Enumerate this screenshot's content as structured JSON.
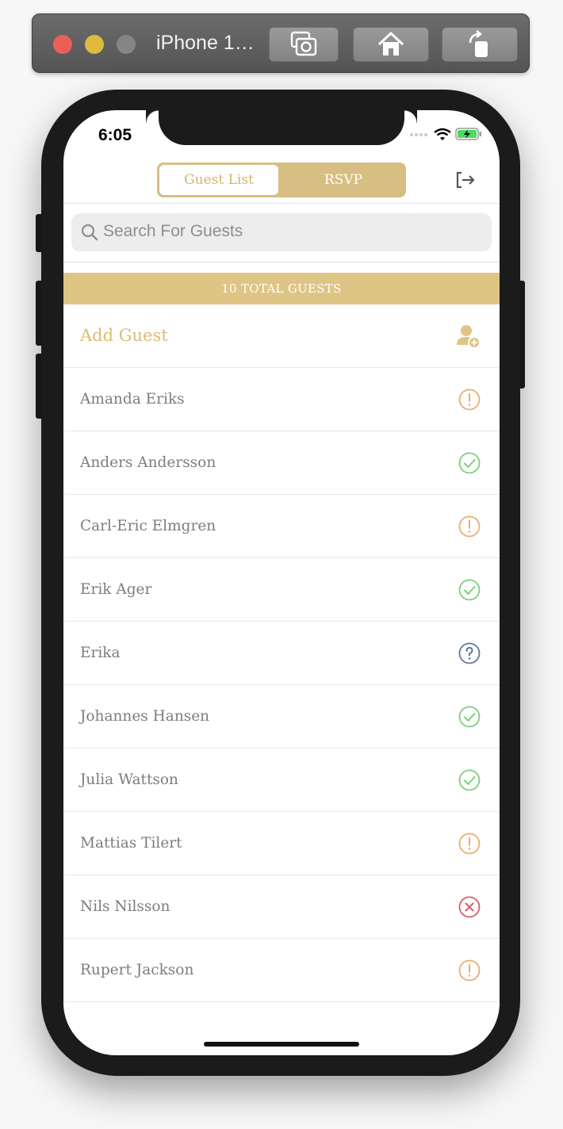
{
  "simulator": {
    "title": "iPhone 1…"
  },
  "status_bar": {
    "time": "6:05"
  },
  "header": {
    "tabs": [
      {
        "label": "Guest List",
        "active": true
      },
      {
        "label": "RSVP",
        "active": false
      }
    ]
  },
  "search": {
    "placeholder": "Search For Guests"
  },
  "banner": {
    "text": "10 TOTAL GUESTS"
  },
  "add_guest": {
    "label": "Add Guest"
  },
  "guests": [
    {
      "name": "Amanda Eriks",
      "status": "pending"
    },
    {
      "name": "Anders Andersson",
      "status": "attending"
    },
    {
      "name": "Carl-Eric Elmgren",
      "status": "pending"
    },
    {
      "name": "Erik Ager",
      "status": "attending"
    },
    {
      "name": "Erika",
      "status": "unknown"
    },
    {
      "name": "Johannes Hansen",
      "status": "attending"
    },
    {
      "name": "Julia Wattson",
      "status": "attending"
    },
    {
      "name": "Mattias Tilert",
      "status": "pending"
    },
    {
      "name": "Nils Nilsson",
      "status": "declined"
    },
    {
      "name": "Rupert Jackson",
      "status": "pending"
    }
  ],
  "colors": {
    "gold": "#d7be82",
    "pending": "#e9ad6e",
    "attending": "#7ccf7b",
    "unknown": "#5c7a98",
    "declined": "#d65d6a"
  }
}
